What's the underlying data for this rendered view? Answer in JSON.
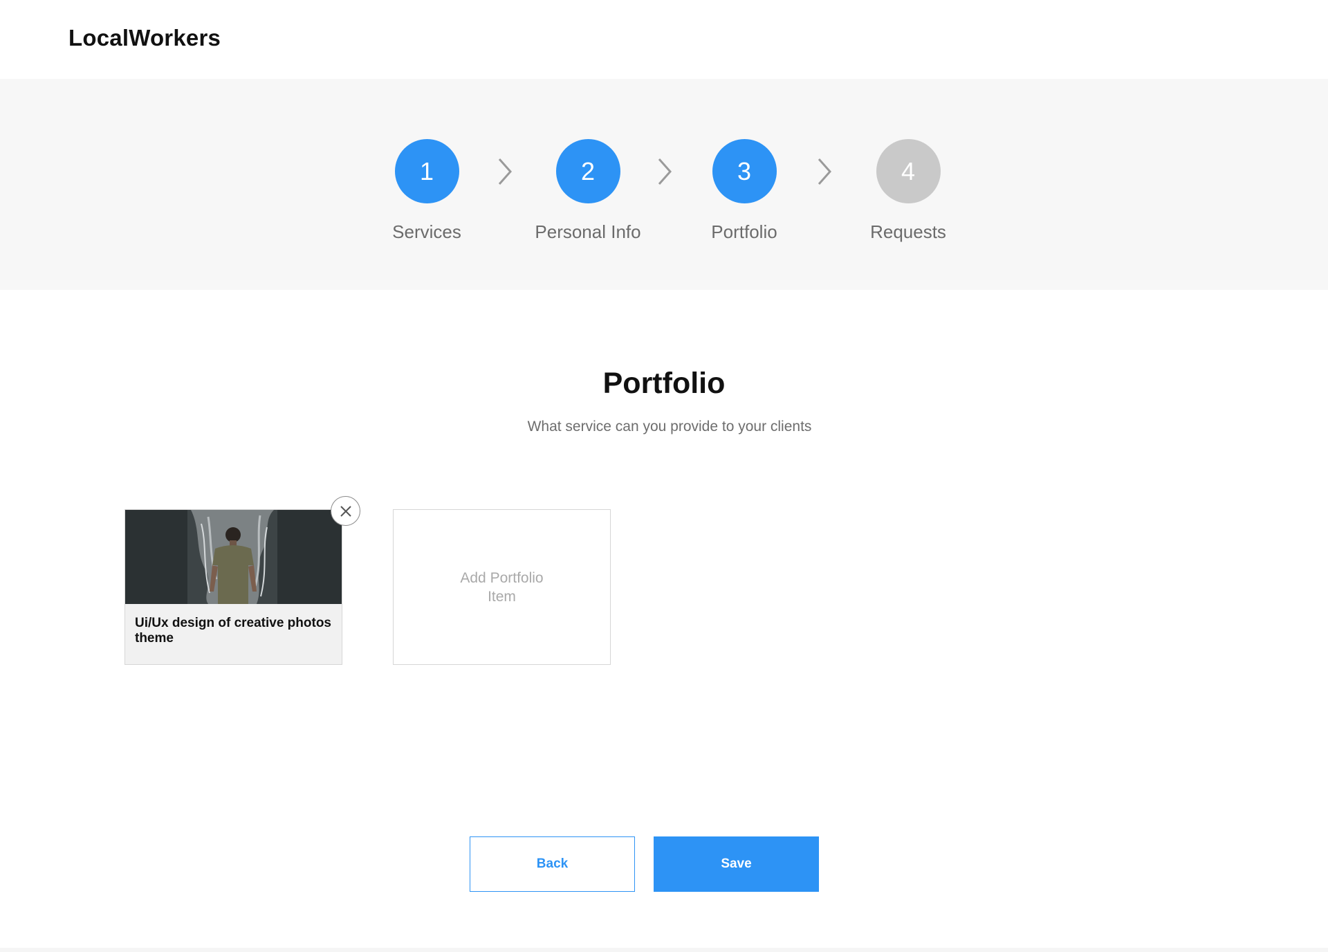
{
  "app": {
    "logo": "LocalWorkers"
  },
  "stepper": {
    "steps": [
      {
        "number": "1",
        "label": "Services",
        "state": "complete"
      },
      {
        "number": "2",
        "label": "Personal Info",
        "state": "complete"
      },
      {
        "number": "3",
        "label": "Portfolio",
        "state": "active"
      },
      {
        "number": "4",
        "label": "Requests",
        "state": "pending"
      }
    ],
    "separator_icon": "chevron-right-icon"
  },
  "main": {
    "title": "Portfolio",
    "subtitle": "What service can you provide to your clients"
  },
  "portfolio": {
    "items": [
      {
        "caption": "Ui/Ux design of creative photos theme",
        "image": "photo of a man in front of a waterfall",
        "remove_icon": "close-icon"
      }
    ],
    "add_label": "Add Portfolio Item"
  },
  "actions": {
    "back_label": "Back",
    "save_label": "Save"
  },
  "colors": {
    "accent": "#2d93f5",
    "pending": "#c9c9c9",
    "stepper_bg": "#f7f7f7"
  }
}
